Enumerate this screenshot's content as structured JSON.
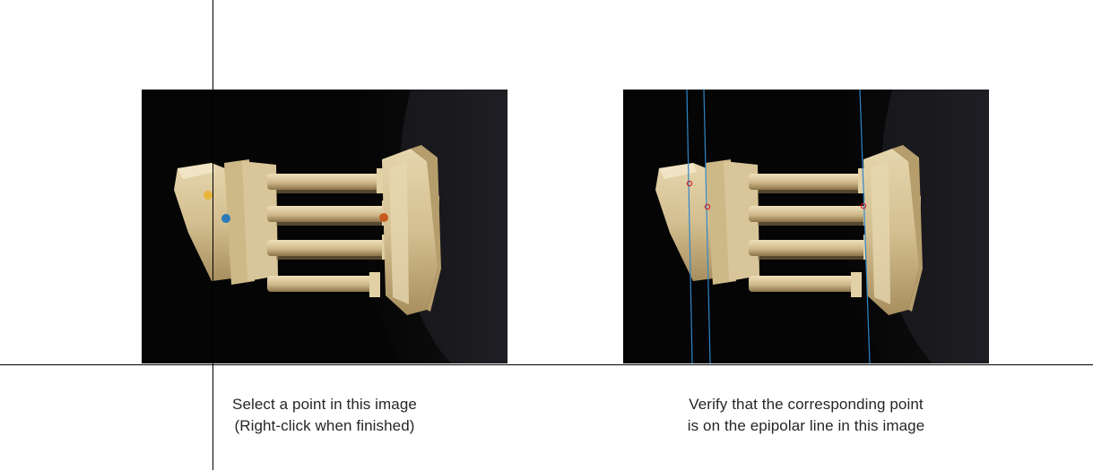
{
  "left_panel": {
    "caption_line1": "Select a point in this image",
    "caption_line2": "(Right-click when finished)",
    "selected_points": [
      {
        "name": "point-yellow",
        "color": "#e8b43a"
      },
      {
        "name": "point-blue",
        "color": "#2a7ab8"
      },
      {
        "name": "point-orange",
        "color": "#c75a1f"
      }
    ]
  },
  "right_panel": {
    "caption_line1": "Verify that the corresponding point",
    "caption_line2": "is on the epipolar line in this image",
    "epipolar_line_color": "#2f86c8",
    "marker_color": "#d0202a",
    "epipolar_lines_count": 3
  },
  "colors": {
    "background": "#ffffff",
    "image_background": "#050505",
    "temple_stone": "#d9c79a",
    "crosshair": "#000000"
  }
}
